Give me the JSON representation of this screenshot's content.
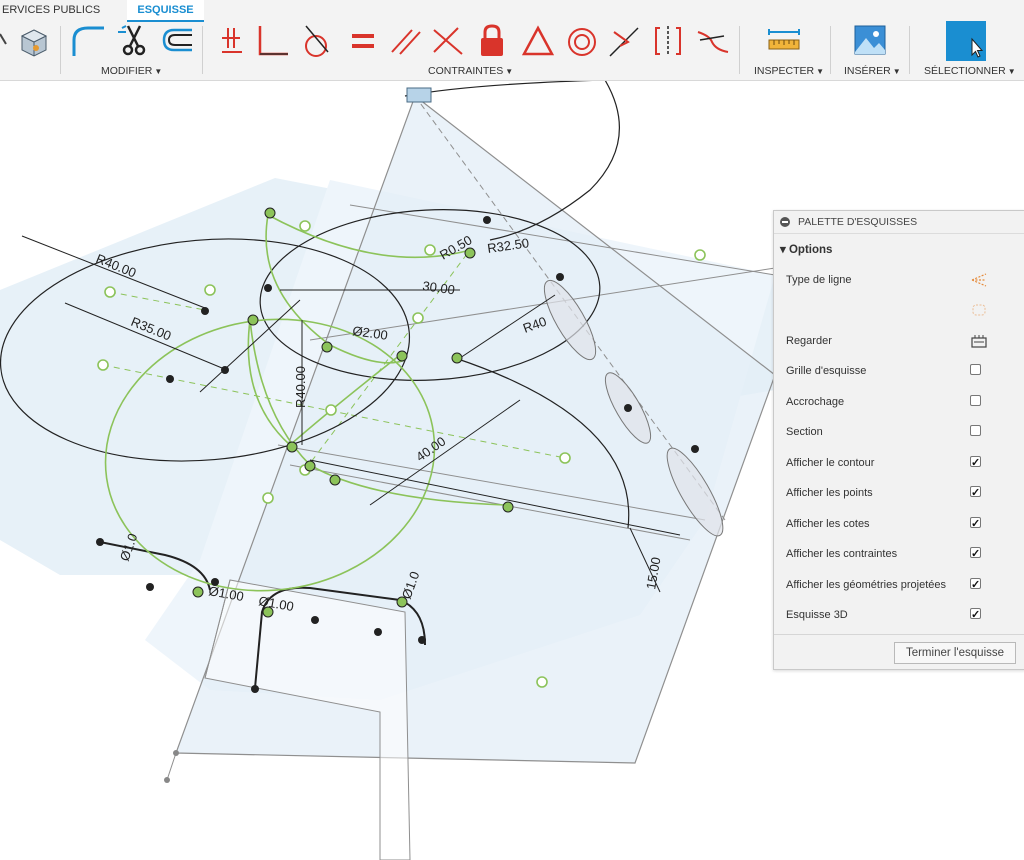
{
  "tabs": {
    "services": "ERVICES PUBLICS",
    "esquisse": "ESQUISSE"
  },
  "groups": {
    "modifier": "MODIFIER",
    "contraintes": "CONTRAINTES",
    "inspecter": "INSPECTER",
    "inserer": "INSÉRER",
    "selectionner": "SÉLECTIONNER"
  },
  "canvas": {
    "dims": {
      "r40_left": "R40.00",
      "r35": "R35.00",
      "r40_vert": "R40.00",
      "d30": "30.00",
      "d2": "Ø2.00",
      "r32": "R32.50",
      "r0": "R0.50",
      "r40_right": "R40",
      "d40": "40.00",
      "d15": "15.00",
      "d1a": "Ø1.00",
      "d1b": "Ø1.00",
      "d1c": "Ø1.0",
      "d1d": "Ø1.0"
    }
  },
  "palette": {
    "title": "PALETTE D'ESQUISSES",
    "options_label": "Options",
    "line_type": "Type de ligne",
    "look": "Regarder",
    "items": [
      {
        "label": "Grille d'esquisse",
        "checked": false
      },
      {
        "label": "Accrochage",
        "checked": false
      },
      {
        "label": "Section",
        "checked": false
      },
      {
        "label": "Afficher le contour",
        "checked": true
      },
      {
        "label": "Afficher les points",
        "checked": true
      },
      {
        "label": "Afficher les cotes",
        "checked": true
      },
      {
        "label": "Afficher les contraintes",
        "checked": true
      },
      {
        "label": "Afficher les géométries projetées",
        "checked": true
      },
      {
        "label": "Esquisse 3D",
        "checked": true
      }
    ],
    "finish_button": "Terminer l'esquisse"
  },
  "colors": {
    "accent": "#1a8ed1",
    "sketch_green": "#8cc35a",
    "constraint_red": "#d9342b",
    "plane_fill": "#e7f1f8"
  }
}
